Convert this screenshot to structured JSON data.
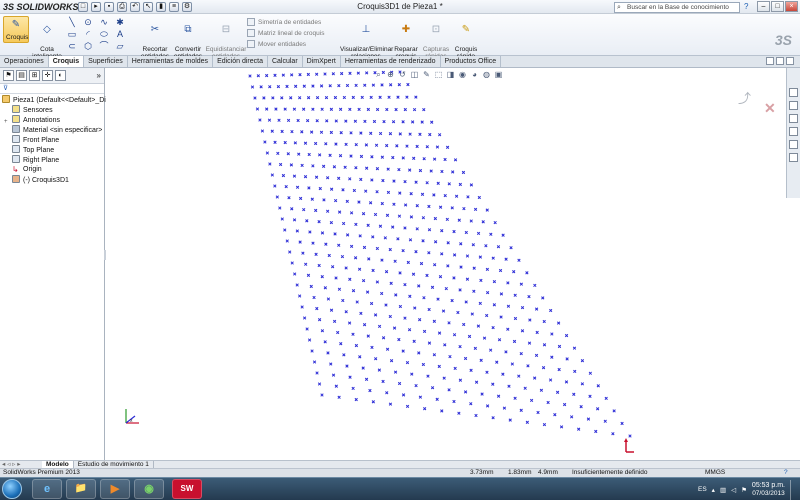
{
  "app": {
    "logo_main": "3S SOLID",
    "logo_sub": "WORKS",
    "title": "Croquis3D1 de Pieza1 *",
    "search_placeholder": "Buscar en la Base de conocimiento",
    "help": "?"
  },
  "ribbon": {
    "croquis": "Croquis",
    "cota": "Cota\ninteligente",
    "recortar": "Recortar\nentidades",
    "convertir": "Convertir\nentidades",
    "equidistanciar": "Equidistanciar\nentidades",
    "simetria": "Simetría de entidades",
    "matriz": "Matriz lineal de croquis",
    "mover": "Mover entidades",
    "visualizar": "Visualizar/Eliminar\nrelaciones",
    "reparar": "Reparar\ncroquis",
    "capturas": "Capturas\nrápidas",
    "croquis_rapido": "Croquis\nrápido"
  },
  "tabs": [
    "Operaciones",
    "Croquis",
    "Superficies",
    "Herramientas de moldes",
    "Edición directa",
    "Calcular",
    "DimXpert",
    "Herramientas de renderizado",
    "Productos Office"
  ],
  "tree": {
    "root": "Pieza1  (Default<<Default>_Dis",
    "items": [
      "Sensores",
      "Annotations",
      "Material <sin especificar>",
      "Front Plane",
      "Top Plane",
      "Right Plane",
      "Origin",
      "(-) Croquis3D1"
    ]
  },
  "model_tabs": [
    "Modelo",
    "Estudio de movimiento 1"
  ],
  "status": {
    "app_name": "SolidWorks Premium 2013",
    "x": "3.73mm",
    "y": "1.83mm",
    "z": "4.9mm",
    "state": "Insuficientemente definido",
    "units": "MMGS",
    "help": "?"
  },
  "taskbar": {
    "lang": "ES",
    "time": "05:53 p.m.",
    "date": "07/03/2013",
    "apps": [
      "e",
      "📁",
      "▶",
      "◉",
      "SW"
    ]
  },
  "colors": {
    "point": "#2b2bd6",
    "accent": "#c8102e",
    "origin": "#c8102e"
  },
  "grid": {
    "rows": 30,
    "cols": 19
  }
}
